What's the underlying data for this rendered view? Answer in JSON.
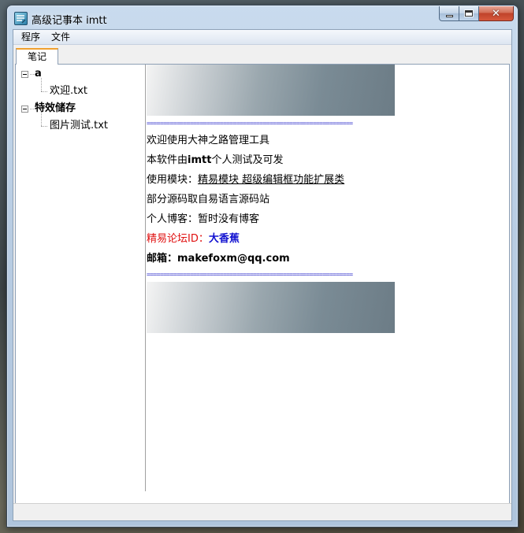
{
  "window": {
    "title": "高级记事本 imtt",
    "close_glyph": "✕"
  },
  "menu": {
    "items": [
      "程序",
      "文件"
    ]
  },
  "tabs": [
    {
      "label": "笔记",
      "active": true
    }
  ],
  "tree": {
    "nodes": [
      {
        "label": "a",
        "bold": true,
        "children": [
          {
            "label": "欢迎.txt"
          }
        ]
      },
      {
        "label": "特效储存",
        "bold": true,
        "children": [
          {
            "label": "图片测试.txt"
          }
        ]
      }
    ]
  },
  "content": {
    "separator": "==============================================================",
    "line1": "欢迎使用大神之路管理工具",
    "line2_prefix": "本软件由",
    "line2_bold": "imtt",
    "line2_suffix": "个人测试及可发",
    "line3_prefix": "使用模块：",
    "line3_link": "精易模块 超级编辑框功能扩展类",
    "line4": "部分源码取自易语言源码站",
    "line5": "个人博客：暂时没有博客",
    "line6_label": "精易论坛ID：",
    "line6_value": "大香蕉",
    "line7": "邮箱：makefoxm@qq.com"
  },
  "colors": {
    "separator": "#2323c8",
    "forum_label": "#e01010",
    "forum_value": "#1010d0",
    "tab_accent": "#f0a030"
  }
}
